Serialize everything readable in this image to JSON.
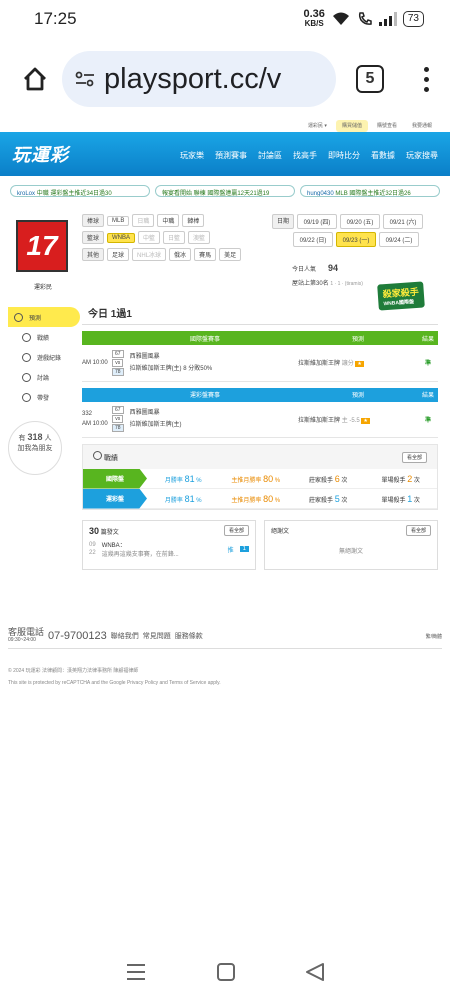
{
  "status": {
    "time": "17:25",
    "net_speed": "0.36",
    "net_unit": "KB/S",
    "battery": "73"
  },
  "browser": {
    "url": "playsport.cc/v",
    "tab_count": "5"
  },
  "site": {
    "topstrip": [
      "運彩民 ▾",
      "購買儲值",
      "購號查看",
      "我要通報"
    ],
    "logo": "玩運彩",
    "nav": [
      "玩家樂",
      "預測賽事",
      "討論區",
      "找高手",
      "即時比分",
      "看數據",
      "玩家搜尋"
    ],
    "ticker": [
      {
        "user": "kroLox",
        "text": "中職 運彩盤主推近34日過30"
      },
      {
        "user": "",
        "text": "報宴看開始 聯棟 國際盤連贏12天21過19"
      },
      {
        "user": "hung0430",
        "text": "MLB 國際盤主推近32日過26"
      }
    ]
  },
  "sidebar": {
    "avatar": "17",
    "username": "運彩民",
    "menu": [
      "預測",
      "戰績",
      "遊戲紀錄",
      "討論",
      "帶發"
    ],
    "followers_pre": "有",
    "followers_count": "318",
    "followers_post": "人",
    "followers_line2": "加我為朋友"
  },
  "filters": {
    "row1_label": "棒球",
    "row1": [
      "MLB",
      "日職",
      "中職",
      "韓棒"
    ],
    "row2_label": "籃球",
    "row2": [
      "WNBA",
      "中籃",
      "日籃",
      "澳籃"
    ],
    "row3_label": "其他",
    "row3": [
      "足球",
      "NHL冰球",
      "俄冰",
      "賽馬",
      "美足"
    ],
    "date_label": "日期",
    "dates": [
      "09/19 (四)",
      "09/20 (五)",
      "09/21 (六)",
      "09/22 (日)",
      "09/23 (一)",
      "09/24 (二)"
    ]
  },
  "stats": {
    "today_label": "今日人氣",
    "today_value": "94",
    "rank_label": "屋站上第30名",
    "rank_sub": "1 · 1 · (tiramis)"
  },
  "today": {
    "title": "今日 1過1",
    "badge": "殺家殺手",
    "badge_sub": "WNBA國際盤"
  },
  "table_intl": {
    "headers": [
      "國際盤賽事",
      "預測",
      "結果"
    ],
    "time": "AM 10:00",
    "score_home": "67",
    "score_vs": "vs",
    "score_away": "78",
    "team1": "西雅圖風暴",
    "team2": "拉斯維加斯王牌(主) 8 分敗50%",
    "pick": "拉斯維加斯王牌",
    "pick_note": "讓分",
    "result": "準"
  },
  "table_lottery": {
    "headers": [
      "運彩盤賽事",
      "預測",
      "結果"
    ],
    "game_no": "332",
    "time": "AM 10:00",
    "score_home": "67",
    "score_vs": "vs",
    "score_away": "78",
    "team1": "西雅圖風暴",
    "team2": "拉斯維加斯王牌(主)",
    "pick": "拉斯維加斯王牌",
    "pick_note": "主 -5.5",
    "result": "準"
  },
  "record": {
    "title": "戰績",
    "more": "看全部",
    "rows": [
      {
        "label": "國際盤",
        "month_rate_label": "月勝率",
        "month_rate": "81",
        "host_rate_label": "主推月勝率",
        "host_rate": "80",
        "killer_label": "莊家殺手",
        "killer": "6",
        "unit1": "次",
        "single_label": "單場殺手",
        "single": "2",
        "unit2": "次"
      },
      {
        "label": "運彩盤",
        "month_rate_label": "月勝率",
        "month_rate": "81",
        "host_rate_label": "主推月勝率",
        "host_rate": "80",
        "killer_label": "莊家殺手",
        "killer": "5",
        "unit1": "次",
        "single_label": "單場殺手",
        "single": "1",
        "unit2": "次"
      }
    ]
  },
  "posts": {
    "count": "30",
    "title": "篇發文",
    "more": "看全部",
    "date_m": "09",
    "date_d": "22",
    "post_title": "WNBA：",
    "post_body": "這幾再這幾支事賽，在前鋒...",
    "tag": "推",
    "tag_num": "1"
  },
  "replies": {
    "title": "絕謝文",
    "more": "看全部",
    "empty": "無絕謝文"
  },
  "footer": {
    "tel_label": "客服電話",
    "tel_hours": "09:30~24:00",
    "tel": "07-9700123",
    "links": [
      "聯絡我們",
      "常見問題",
      "服務條款"
    ],
    "lang": "繁/簡體",
    "copy": "© 2024 玩運彩 法律顧問：漢英翔力法律事務所 陳顧福律師",
    "recaptcha": "This site is protected by reCAPTCHA and the Google Privacy Policy and Terms of Service apply."
  }
}
